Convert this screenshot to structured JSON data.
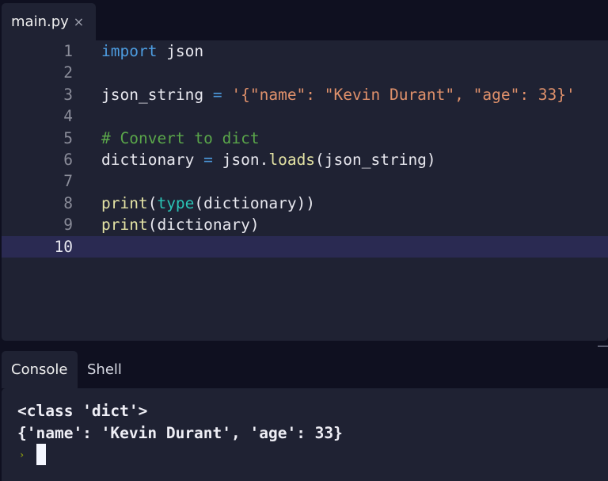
{
  "tab": {
    "filename": "main.py",
    "close_icon": "×"
  },
  "editor": {
    "line_numbers": [
      "1",
      "2",
      "3",
      "4",
      "5",
      "6",
      "7",
      "8",
      "9",
      "10"
    ],
    "active_line": 10,
    "lines": {
      "l1": {
        "kw": "import",
        "rest": " json"
      },
      "l3": {
        "a": "json_string ",
        "op": "=",
        "s": " '{\"name\": \"Kevin Durant\", \"age\": 33}'"
      },
      "l5": {
        "comment": "# Convert to dict"
      },
      "l6": {
        "a": "dictionary ",
        "op": "=",
        "b": " json.",
        "fn": "loads",
        "c": "(json_string)"
      },
      "l8": {
        "fn": "print",
        "a": "(",
        "bi": "type",
        "b": "(dictionary))"
      },
      "l9": {
        "fn": "print",
        "a": "(dictionary)"
      }
    }
  },
  "console_tabs": {
    "console": "Console",
    "shell": "Shell"
  },
  "console": {
    "output": [
      "<class 'dict'>",
      "{'name': 'Kevin Durant', 'age': 33}"
    ],
    "prompt": "›"
  }
}
